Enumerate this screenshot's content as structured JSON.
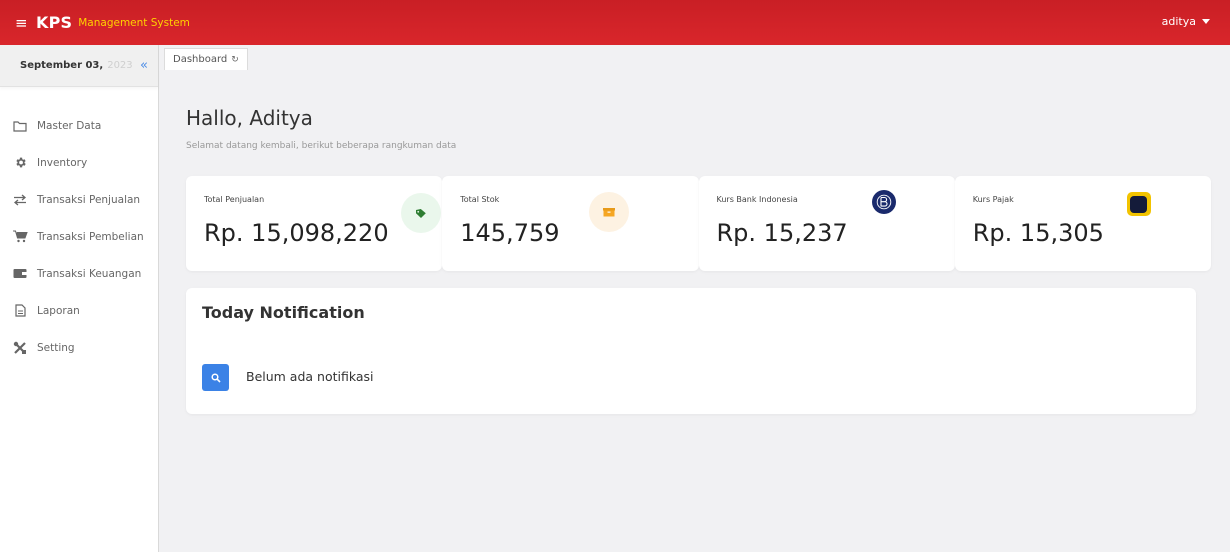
{
  "header": {
    "brand": "KPS",
    "brand_sub": "Management System",
    "user": "aditya"
  },
  "sidebar": {
    "date_main": "September 03,",
    "date_year": "2023",
    "items": [
      {
        "label": "Master Data",
        "icon": "folder-icon"
      },
      {
        "label": "Inventory",
        "icon": "gear-icon"
      },
      {
        "label": "Transaksi Penjualan",
        "icon": "swap-icon"
      },
      {
        "label": "Transaksi Pembelian",
        "icon": "cart-icon"
      },
      {
        "label": "Transaksi Keuangan",
        "icon": "wallet-icon"
      },
      {
        "label": "Laporan",
        "icon": "document-icon"
      },
      {
        "label": "Setting",
        "icon": "tools-icon"
      }
    ]
  },
  "tabs": [
    {
      "label": "Dashboard"
    }
  ],
  "main": {
    "greeting": "Hallo, Aditya",
    "subtitle": "Selamat datang kembali, berikut beberapa rangkuman data"
  },
  "stats": [
    {
      "label": "Total Penjualan",
      "value": "Rp. 15,098,220",
      "icon": "tag-icon",
      "color": "#2e7d32"
    },
    {
      "label": "Total Stok",
      "value": "145,759",
      "icon": "box-icon",
      "color": "#f5a623"
    },
    {
      "label": "Kurs Bank Indonesia",
      "value": "Rp. 15,237",
      "icon": "bank-indonesia-logo-icon",
      "color": "#1a2a6c"
    },
    {
      "label": "Kurs Pajak",
      "value": "Rp. 15,305",
      "icon": "tax-logo-icon",
      "color": "#f2c300"
    }
  ],
  "notification": {
    "title": "Today Notification",
    "empty_text": "Belum ada notifikasi"
  },
  "colors": {
    "header_red": "#d9262b",
    "brand_yellow": "#ffd200",
    "accent_blue": "#3b82e6"
  }
}
